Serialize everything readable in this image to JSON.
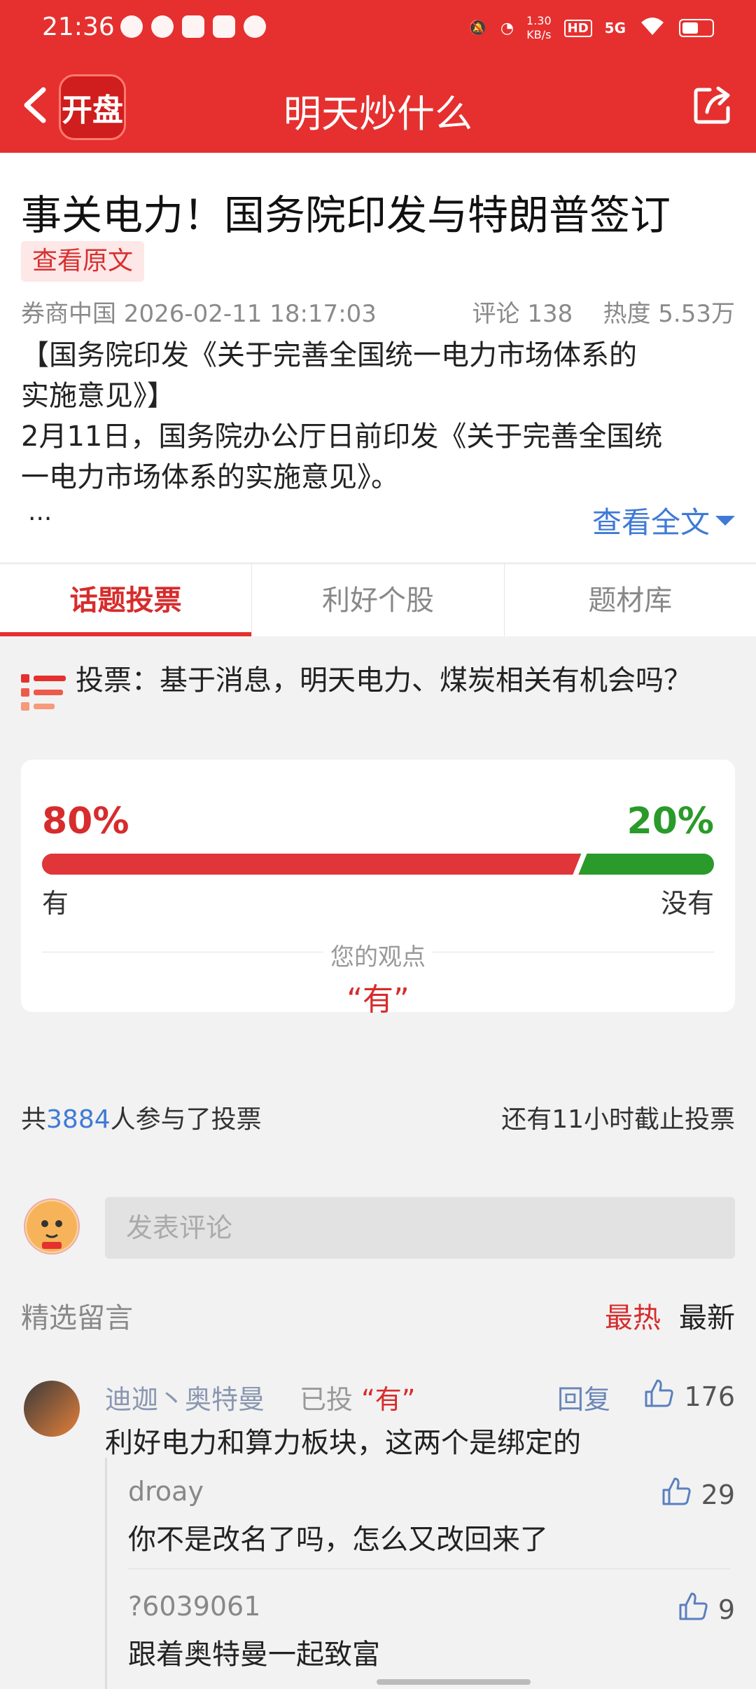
{
  "status_bar": {
    "time": "21:36",
    "net_speed_value": "1.30",
    "net_speed_unit": "KB/s",
    "hd": "HD",
    "signal": "5G"
  },
  "header": {
    "logo_text": "开盘",
    "title": "明天炒什么"
  },
  "article": {
    "title": "事关电力！国务院印发与特朗普签订",
    "view_original": "查看原文",
    "source_time": "券商中国 2026-02-11 18:17:03",
    "comments_label": "评论 138",
    "heat_label": "热度 5.53万",
    "body_line1": "【国务院印发《关于完善全国统一电力市场体系的",
    "body_line2": "实施意见》】",
    "body_line3": "2月11日，国务院办公厅日前印发《关于完善全国统",
    "body_line4": "一电力市场体系的实施意见》。",
    "ellipsis": "...",
    "view_full": "查看全文"
  },
  "tabs": [
    "话题投票",
    "利好个股",
    "题材库"
  ],
  "vote": {
    "question": "投票：基于消息，明天电力、煤炭相关有机会吗？",
    "yes_pct_label": "80%",
    "no_pct_label": "20%",
    "yes_fraction": 0.8,
    "yes_label": "有",
    "no_label": "没有",
    "opinion_title": "您的观点",
    "opinion_value": "“有”",
    "participants_prefix": "共",
    "participants_count": "3884",
    "participants_suffix": "人参与了投票",
    "deadline": "还有11小时截止投票"
  },
  "comments": {
    "placeholder": "发表评论",
    "section_title": "精选留言",
    "sort_hot": "最热",
    "sort_new": "最新",
    "items": [
      {
        "user": "迪迦丶奥特曼",
        "voted_prefix": "已投",
        "voted_value": "“有”",
        "reply_label": "回复",
        "likes": "176",
        "text": "利好电力和算力板块，这两个是绑定的",
        "replies": [
          {
            "user": "droay",
            "likes": "29",
            "text": "你不是改名了吗，怎么又改回来了"
          },
          {
            "user": "?6039061",
            "likes": "9",
            "text": "跟着奥特曼一起致富"
          }
        ]
      }
    ]
  },
  "colors": {
    "brand_red": "#e5302f",
    "yes_red": "#e0363a",
    "no_green": "#2a9a2a",
    "link_blue": "#3f7ad6"
  },
  "icons": [
    "back-arrow-icon",
    "share-icon",
    "vote-list-icon",
    "thumbs-up-icon",
    "caret-down-icon"
  ]
}
